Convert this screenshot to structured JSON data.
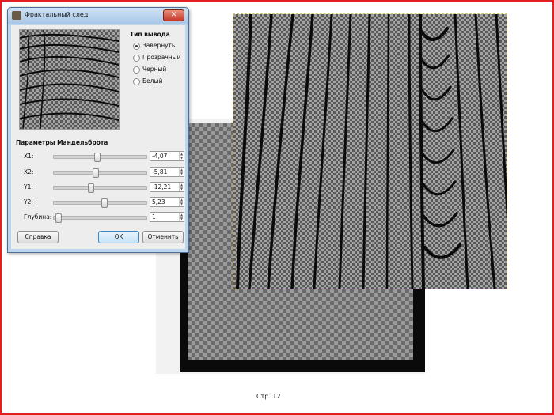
{
  "dialog": {
    "title": "Фрактальный след",
    "close_symbol": "✕",
    "app_icon": "gimp-icon"
  },
  "output_type": {
    "heading": "Тип вывода",
    "options": [
      {
        "label": "Завернуть",
        "selected": true
      },
      {
        "label": "Прозрачный",
        "selected": false
      },
      {
        "label": "Черный",
        "selected": false
      },
      {
        "label": "Белый",
        "selected": false
      }
    ]
  },
  "mandelbrot": {
    "heading": "Параметры Мандельброта",
    "params": [
      {
        "label": "X1:",
        "value": "-4,07",
        "slider_fraction": 0.47
      },
      {
        "label": "X2:",
        "value": "-5,81",
        "slider_fraction": 0.45
      },
      {
        "label": "Y1:",
        "value": "-12,21",
        "slider_fraction": 0.39
      },
      {
        "label": "Y2:",
        "value": "5,23",
        "slider_fraction": 0.55
      },
      {
        "label": "Глубина:",
        "value": "1",
        "slider_fraction": 0.02
      }
    ]
  },
  "buttons": {
    "help": "Справка",
    "ok": "OK",
    "cancel": "Отменить"
  },
  "footer": {
    "page_number": "Стр. 12."
  },
  "colors": {
    "frame_border": "#e32020",
    "dialog_accent": "#3b88c8"
  }
}
